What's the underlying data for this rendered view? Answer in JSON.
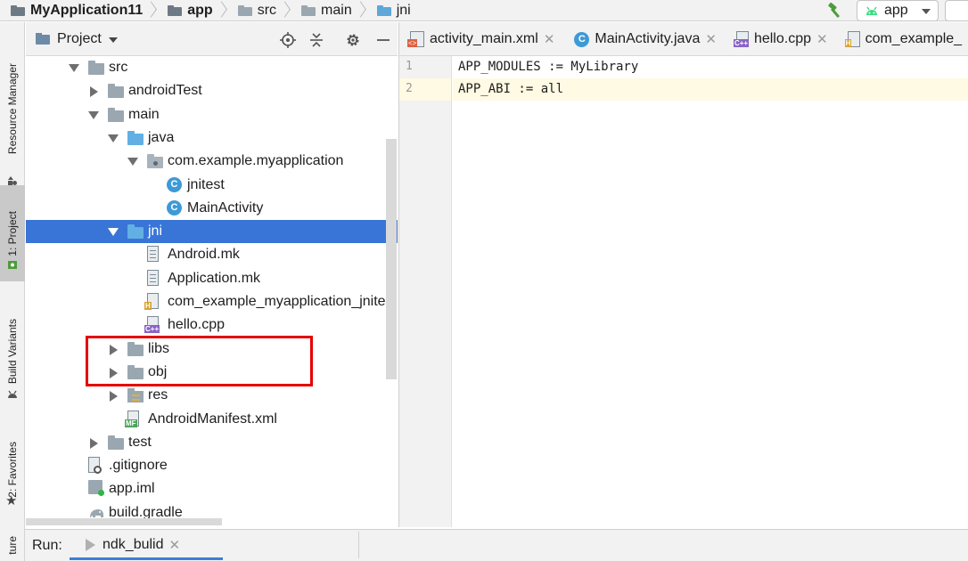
{
  "breadcrumb": {
    "items": [
      {
        "label": "MyApplication11",
        "icon": "module-folder-icon"
      },
      {
        "label": "app",
        "icon": "module-folder-icon"
      },
      {
        "label": "src",
        "icon": "folder-icon"
      },
      {
        "label": "main",
        "icon": "folder-icon"
      },
      {
        "label": "jni",
        "icon": "source-folder-icon"
      }
    ]
  },
  "toolbar": {
    "run_config": "app"
  },
  "left_strip": {
    "tabs": [
      "Resource Manager",
      "1: Project",
      "Build Variants",
      "2: Favorites",
      "ture"
    ]
  },
  "project_panel": {
    "title": "Project"
  },
  "tree": [
    {
      "label": "src",
      "level": 2,
      "toggle": "open",
      "icon": "folder"
    },
    {
      "label": "androidTest",
      "level": 3,
      "toggle": "closed",
      "icon": "folder"
    },
    {
      "label": "main",
      "level": 3,
      "toggle": "open",
      "icon": "folder"
    },
    {
      "label": "java",
      "level": 4,
      "toggle": "open",
      "icon": "source-folder"
    },
    {
      "label": "com.example.myapplication",
      "level": 5,
      "toggle": "open",
      "icon": "package"
    },
    {
      "label": "jnitest",
      "level": 6,
      "toggle": "none",
      "icon": "class"
    },
    {
      "label": "MainActivity",
      "level": 6,
      "toggle": "none",
      "icon": "class"
    },
    {
      "label": "jni",
      "level": 4,
      "toggle": "open",
      "icon": "source-folder",
      "selected": true
    },
    {
      "label": "Android.mk",
      "level": 5,
      "toggle": "none",
      "icon": "text-file"
    },
    {
      "label": "Application.mk",
      "level": 5,
      "toggle": "none",
      "icon": "text-file"
    },
    {
      "label": "com_example_myapplication_jnitest.h",
      "level": 5,
      "toggle": "none",
      "icon": "header-file"
    },
    {
      "label": "hello.cpp",
      "level": 5,
      "toggle": "none",
      "icon": "cpp-file"
    },
    {
      "label": "libs",
      "level": 4,
      "toggle": "closed",
      "icon": "folder"
    },
    {
      "label": "obj",
      "level": 4,
      "toggle": "closed",
      "icon": "folder"
    },
    {
      "label": "res",
      "level": 4,
      "toggle": "closed",
      "icon": "res-folder"
    },
    {
      "label": "AndroidManifest.xml",
      "level": 4,
      "toggle": "none",
      "icon": "manifest-file"
    },
    {
      "label": "test",
      "level": 3,
      "toggle": "closed",
      "icon": "folder"
    },
    {
      "label": ".gitignore",
      "level": 2,
      "toggle": "none",
      "icon": "ignore-file"
    },
    {
      "label": "app.iml",
      "level": 2,
      "toggle": "none",
      "icon": "iml-file"
    },
    {
      "label": "build.gradle",
      "level": 2,
      "toggle": "none",
      "icon": "gradle-file"
    }
  ],
  "editor": {
    "tabs": [
      {
        "label": "activity_main.xml",
        "icon": "xml-file-icon"
      },
      {
        "label": "MainActivity.java",
        "icon": "class-icon"
      },
      {
        "label": "hello.cpp",
        "icon": "cpp-file-icon"
      },
      {
        "label": "com_example_",
        "icon": "header-file-icon"
      }
    ],
    "lines": [
      {
        "num": "1",
        "text": "APP_MODULES := MyLibrary"
      },
      {
        "num": "2",
        "text": "APP_ABI := all"
      }
    ],
    "current_line": 2
  },
  "bottom": {
    "run_label": "Run:",
    "run_tab": "ndk_bulid"
  },
  "colors": {
    "selection": "#3875d7",
    "highlight_box": "#e60000",
    "current_line": "#fffae3"
  }
}
